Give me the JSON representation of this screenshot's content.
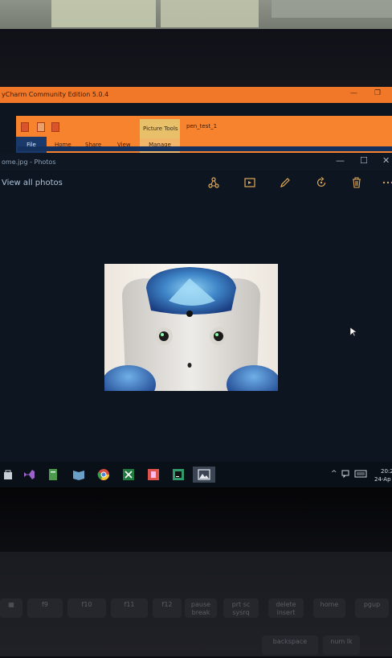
{
  "pycharm": {
    "title": "yCharm Community Edition 5.0.4",
    "minimize": "—",
    "restore": "❐"
  },
  "explorer": {
    "context_group": "Picture Tools",
    "folder_name": "pen_test_1",
    "tabs": {
      "file": "File",
      "home": "Home",
      "share": "Share",
      "view": "View",
      "manage": "Manage"
    }
  },
  "photos": {
    "window_title": "ome.jpg - Photos",
    "minimize": "—",
    "maximize": "☐",
    "close": "✕",
    "view_all": "View all photos",
    "toolbar_icons": [
      "share-icon",
      "slideshow-icon",
      "edit-pencil-icon",
      "rotate-icon",
      "delete-icon",
      "more-icon"
    ]
  },
  "taskbar": {
    "apps": [
      "store-icon",
      "visual-studio-icon",
      "file-icon",
      "book-icon",
      "chrome-icon",
      "excel-icon",
      "onenote-icon",
      "pycharm-icon",
      "photos-icon"
    ],
    "time": "20:2",
    "date": "24-Ap"
  },
  "keyboard": {
    "row1": [
      "f9",
      "f10",
      "f11",
      "f12",
      "pause break",
      "prt sc sysrq",
      "delete insert",
      "home",
      "pgup"
    ],
    "row2": [
      "backspace",
      "num lk"
    ]
  },
  "colors": {
    "pycharm_orange": "#f07828",
    "photos_accent": "#e0a85a",
    "screen_bg": "#0d1620"
  }
}
